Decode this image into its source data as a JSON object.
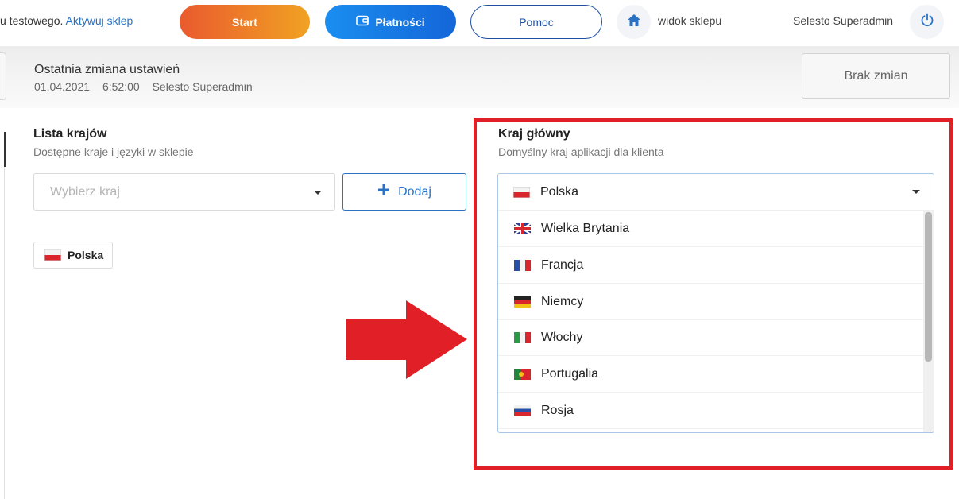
{
  "header": {
    "trial_text": "u testowego.",
    "activate_link": "Aktywuj sklep",
    "start_label": "Start",
    "payments_label": "Płatności",
    "help_label": "Pomoc",
    "store_view_label": "widok sklepu",
    "user_name": "Selesto Superadmin",
    "colors": {
      "start_from": "#ea5a2e",
      "start_to": "#f0a223",
      "payments": "#1a7fe8",
      "help_border": "#1e4fa5"
    }
  },
  "change_bar": {
    "title": "Ostatnia zmiana ustawień",
    "date": "01.04.2021",
    "time": "6:52:00",
    "author": "Selesto Superadmin",
    "no_changes_label": "Brak zmian"
  },
  "country_list": {
    "title": "Lista krajów",
    "subtitle": "Dostępne kraje i języki w sklepie",
    "select_placeholder": "Wybierz kraj",
    "add_label": "Dodaj",
    "chips": [
      {
        "label": "Polska",
        "flag": "flag-pl"
      }
    ]
  },
  "main_country": {
    "title": "Kraj główny",
    "subtitle": "Domyślny kraj aplikacji dla klienta",
    "selected": {
      "label": "Polska",
      "flag": "flag-pl"
    },
    "options": [
      {
        "label": "Wielka Brytania",
        "flag": "flag-gb"
      },
      {
        "label": "Francja",
        "flag": "flag-fr"
      },
      {
        "label": "Niemcy",
        "flag": "flag-de"
      },
      {
        "label": "Włochy",
        "flag": "flag-it"
      },
      {
        "label": "Portugalia",
        "flag": "flag-pt"
      },
      {
        "label": "Rosja",
        "flag": "flag-ru"
      }
    ]
  },
  "annotation": {
    "color": "#e11f26"
  }
}
